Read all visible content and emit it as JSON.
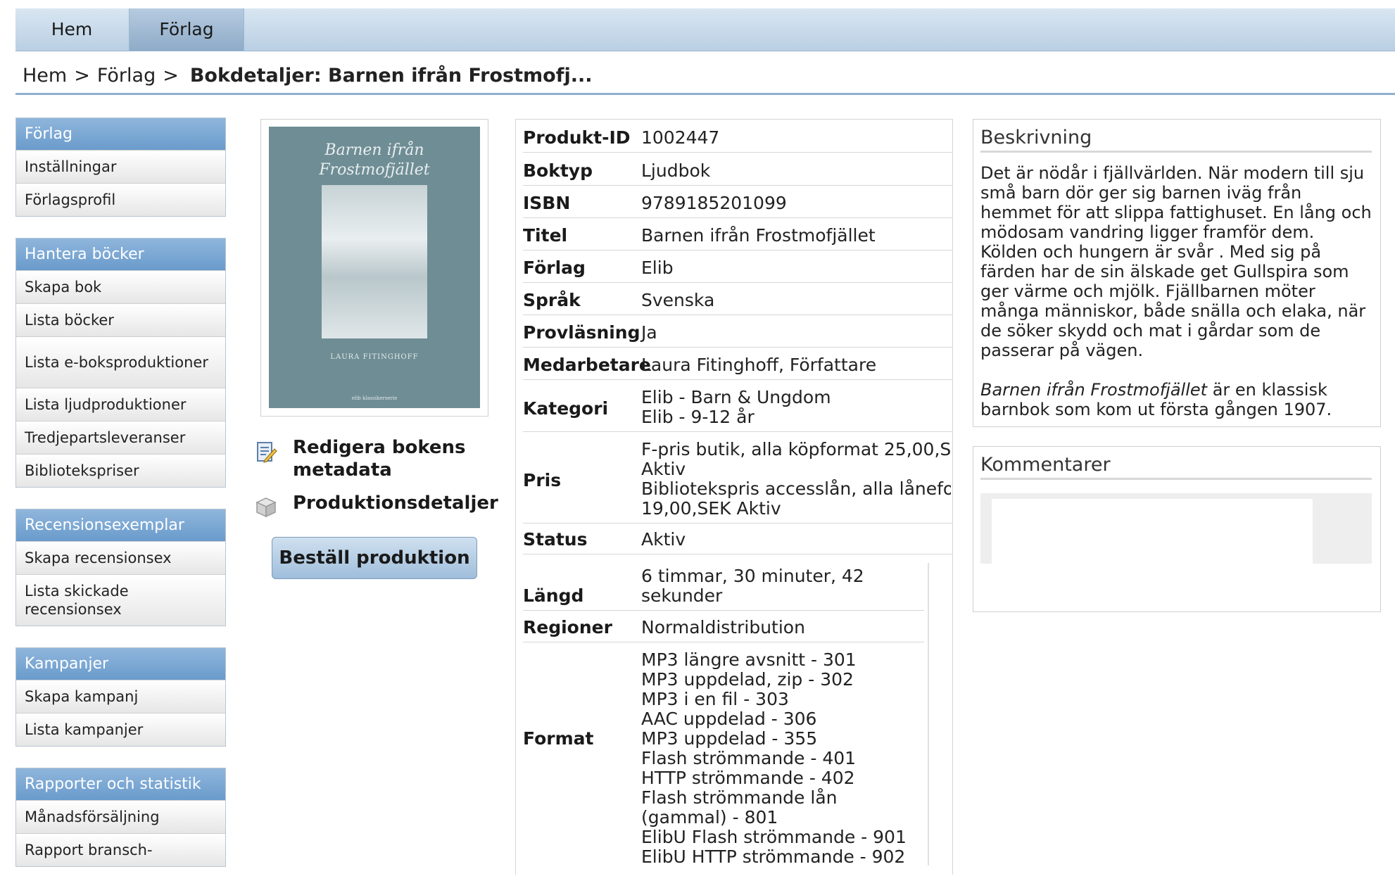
{
  "nav": {
    "tabs": [
      "Hem",
      "Förlag"
    ]
  },
  "breadcrumb": {
    "items": [
      "Hem",
      "Förlag"
    ],
    "separator": ">",
    "current": "Bokdetaljer: Barnen ifrån Frostmofj..."
  },
  "sidebar": {
    "groups": [
      {
        "title": "Förlag",
        "items": [
          "Inställningar",
          "Förlagsprofil"
        ]
      },
      {
        "title": "Hantera böcker",
        "items": [
          "Skapa bok",
          "Lista böcker",
          "Lista e-boksproduktioner",
          "Lista ljudproduktioner",
          "Tredjepartsleveranser",
          "Bibliotekspriser"
        ]
      },
      {
        "title": "Recensionsexemplar",
        "items": [
          "Skapa recensionsex",
          "Lista skickade recensionsex"
        ]
      },
      {
        "title": "Kampanjer",
        "items": [
          "Skapa kampanj",
          "Lista kampanjer"
        ]
      },
      {
        "title": "Rapporter och statistik",
        "items": [
          "Månadsförsäljning",
          "Rapport bransch-"
        ]
      }
    ]
  },
  "cover": {
    "title_line1": "Barnen ifrån",
    "title_line2": "Frostmofjället",
    "author": "LAURA FITINGHOFF",
    "publisher": "elib klassikerserie"
  },
  "actions": {
    "edit_metadata": "Redigera bokens metadata",
    "production_details": "Produktionsdetaljer",
    "order_production": "Beställ produktion"
  },
  "details": [
    {
      "key": "Produkt-ID",
      "value": "1002447"
    },
    {
      "key": "Boktyp",
      "value": "Ljudbok"
    },
    {
      "key": "ISBN",
      "value": "9789185201099"
    },
    {
      "key": "Titel",
      "value": "Barnen ifrån Frostmofjället"
    },
    {
      "key": "Förlag",
      "value": "Elib"
    },
    {
      "key": "Språk",
      "value": "Svenska"
    },
    {
      "key": "Provläsning",
      "value": "Ja"
    },
    {
      "key": "Medarbetare",
      "value": "Laura Fitinghoff, Författare"
    },
    {
      "key": "Kategori",
      "value": "Elib - Barn & Ungdom\nElib - 9-12 år"
    },
    {
      "key": "Pris",
      "value": "F-pris butik, alla köpformat 25,00,S\nAktiv\nBibliotekspris accesslån, alla lånefo\n19,00,SEK Aktiv"
    },
    {
      "key": "Status",
      "value": "Aktiv"
    },
    {
      "key": "Längd",
      "value": "6 timmar, 30 minuter, 42\nsekunder"
    },
    {
      "key": "Regioner",
      "value": "Normaldistribution"
    },
    {
      "key": "Format",
      "value": "MP3 längre avsnitt - 301\nMP3 uppdelad, zip - 302\nMP3 i en fil - 303\nAAC uppdelad - 306\nMP3 uppdelad - 355\nFlash strömmande - 401\nHTTP strömmande - 402\nFlash strömmande lån\n(gammal) - 801\nElibU Flash strömmande - 901\nElibU HTTP strömmande - 902"
    }
  ],
  "description": {
    "title": "Beskrivning",
    "paragraph1": "Det är nödår i fjällvärlden. När modern till sju små barn dör ger sig barnen iväg från hemmet för att slippa fattighuset. En lång och mödosam vandring ligger framför dem. Kölden och hungern är svår . Med sig på färden har de sin älskade get Gullspira som ger värme och mjölk. Fjällbarnen möter många människor, både snälla och elaka, när de söker skydd och mat i gårdar som de passerar på vägen.",
    "paragraph2_title": "Barnen ifrån Frostmofjället",
    "paragraph2_rest": " är en klassisk barnbok som kom ut första gången 1907."
  },
  "comments": {
    "title": "Kommentarer"
  }
}
